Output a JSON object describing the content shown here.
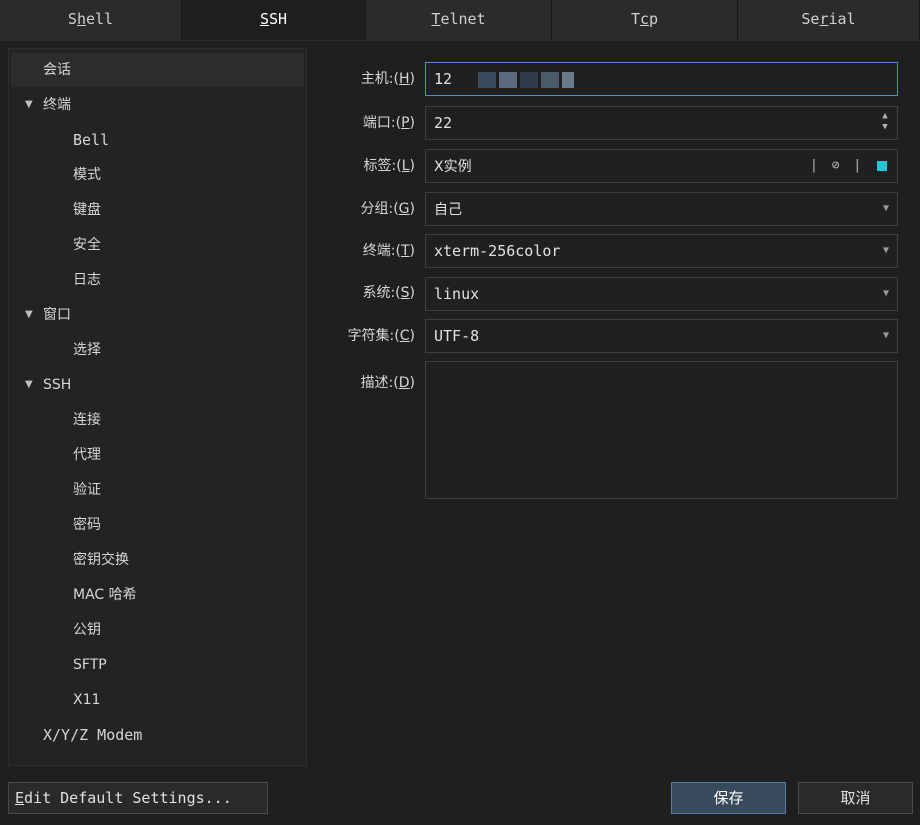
{
  "tabs": [
    {
      "pre": "S",
      "u": "h",
      "post": "ell"
    },
    {
      "pre": "",
      "u": "S",
      "post": "SH"
    },
    {
      "pre": "",
      "u": "T",
      "post": "elnet"
    },
    {
      "pre": "T",
      "u": "c",
      "post": "p"
    },
    {
      "pre": "Se",
      "u": "r",
      "post": "ial"
    }
  ],
  "tree": {
    "session": "会话",
    "terminal": "终端",
    "bell": "Bell",
    "mode": "模式",
    "keyboard": "键盘",
    "security": "安全",
    "log": "日志",
    "window": "窗口",
    "select": "选择",
    "ssh": "SSH",
    "connect": "连接",
    "proxy": "代理",
    "auth": "验证",
    "cipher": "密码",
    "kex": "密钥交换",
    "mac": "MAC 哈希",
    "pubkey": "公钥",
    "sftp": "SFTP",
    "x11": "X11",
    "modem": "X/Y/Z Modem"
  },
  "form": {
    "host": {
      "label_pre": "主机:(",
      "key": "H",
      "label_post": ")",
      "value": "12"
    },
    "port": {
      "label_pre": "端口:(",
      "key": "P",
      "label_post": ")",
      "value": "22"
    },
    "tag": {
      "label_pre": "标签:(",
      "key": "L",
      "label_post": ")",
      "value": "X实例"
    },
    "group": {
      "label_pre": "分组:(",
      "key": "G",
      "label_post": ")",
      "value": "自己"
    },
    "term": {
      "label_pre": "终端:(",
      "key": "T",
      "label_post": ")",
      "value": "xterm-256color"
    },
    "system": {
      "label_pre": "系统:(",
      "key": "S",
      "label_post": ")",
      "value": "linux"
    },
    "charset": {
      "label_pre": "字符集:(",
      "key": "C",
      "label_post": ")",
      "value": "UTF-8"
    },
    "desc": {
      "label_pre": "描述:(",
      "key": "D",
      "label_post": ")"
    }
  },
  "buttons": {
    "edit_u": "E",
    "edit_rest": "dit Default Settings...",
    "save": "保存",
    "cancel": "取消"
  },
  "colors": {
    "accent": "#4a8fd6",
    "tag_color": "#22c4d6"
  }
}
